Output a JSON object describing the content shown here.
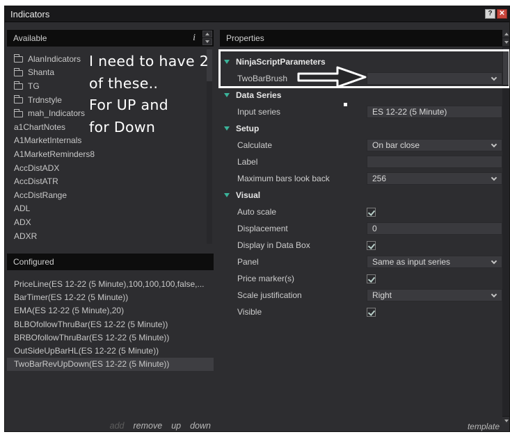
{
  "window": {
    "title": "Indicators",
    "help_button": "?",
    "close_button": "✕"
  },
  "available": {
    "header": "Available",
    "info_icon": "i",
    "folders": [
      "AlanIndicators",
      "Shanta",
      "TG",
      "Trdnstyle",
      "mah_Indicators"
    ],
    "items": [
      "a1ChartNotes",
      "A1MarketInternals",
      "A1MarketReminders8",
      "AccDistADX",
      "AccDistATR",
      "AccDistRange",
      "ADL",
      "ADX",
      "ADXR"
    ]
  },
  "configured": {
    "header": "Configured",
    "items": [
      "PriceLine(ES 12-22 (5 Minute),100,100,100,false,...",
      "BarTimer(ES 12-22 (5 Minute))",
      "EMA(ES 12-22 (5 Minute),20)",
      "BLBOfollowThruBar(ES 12-22 (5 Minute))",
      "BRBOfollowThruBar(ES 12-22 (5 Minute))",
      "OutSideUpBarHL(ES 12-22 (5 Minute))",
      "TwoBarRevUpDown(ES 12-22 (5 Minute))"
    ],
    "selected_index": 6,
    "actions": [
      {
        "label": "add",
        "enabled": false
      },
      {
        "label": "remove",
        "enabled": true
      },
      {
        "label": "up",
        "enabled": true
      },
      {
        "label": "down",
        "enabled": true
      }
    ]
  },
  "properties": {
    "header": "Properties",
    "template_label": "template",
    "groups": [
      {
        "label": "NinjaScriptParameters",
        "rows": [
          {
            "label": "TwoBarBrush",
            "control": "select",
            "value": ""
          }
        ]
      },
      {
        "label": "Data Series",
        "rows": [
          {
            "label": "Input series",
            "control": "text",
            "value": "ES 12-22 (5 Minute)"
          }
        ]
      },
      {
        "label": "Setup",
        "rows": [
          {
            "label": "Calculate",
            "control": "select",
            "value": "On bar close"
          },
          {
            "label": "Label",
            "control": "text",
            "value": ""
          },
          {
            "label": "Maximum bars look back",
            "control": "select",
            "value": "256"
          }
        ]
      },
      {
        "label": "Visual",
        "rows": [
          {
            "label": "Auto scale",
            "control": "checkbox",
            "checked": true
          },
          {
            "label": "Displacement",
            "control": "text",
            "value": "0"
          },
          {
            "label": "Display in Data Box",
            "control": "checkbox",
            "checked": true
          },
          {
            "label": "Panel",
            "control": "select",
            "value": "Same as input series"
          },
          {
            "label": "Price marker(s)",
            "control": "checkbox",
            "checked": true
          },
          {
            "label": "Scale justification",
            "control": "select",
            "value": "Right"
          },
          {
            "label": "Visible",
            "control": "checkbox",
            "checked": true
          }
        ]
      }
    ]
  },
  "annotation": {
    "note_lines": [
      "I need to have 2",
      "of these..",
      "For UP and",
      "for Down"
    ]
  },
  "colors": {
    "accent_teal": "#3bb39a",
    "close_red": "#c8463c",
    "selection_bg": "#3e3e42",
    "annotation_white": "#ffffff",
    "panel_bg": "#2d2d30",
    "header_bg": "#0d0d0d",
    "field_bg": "#3a3a3e"
  }
}
